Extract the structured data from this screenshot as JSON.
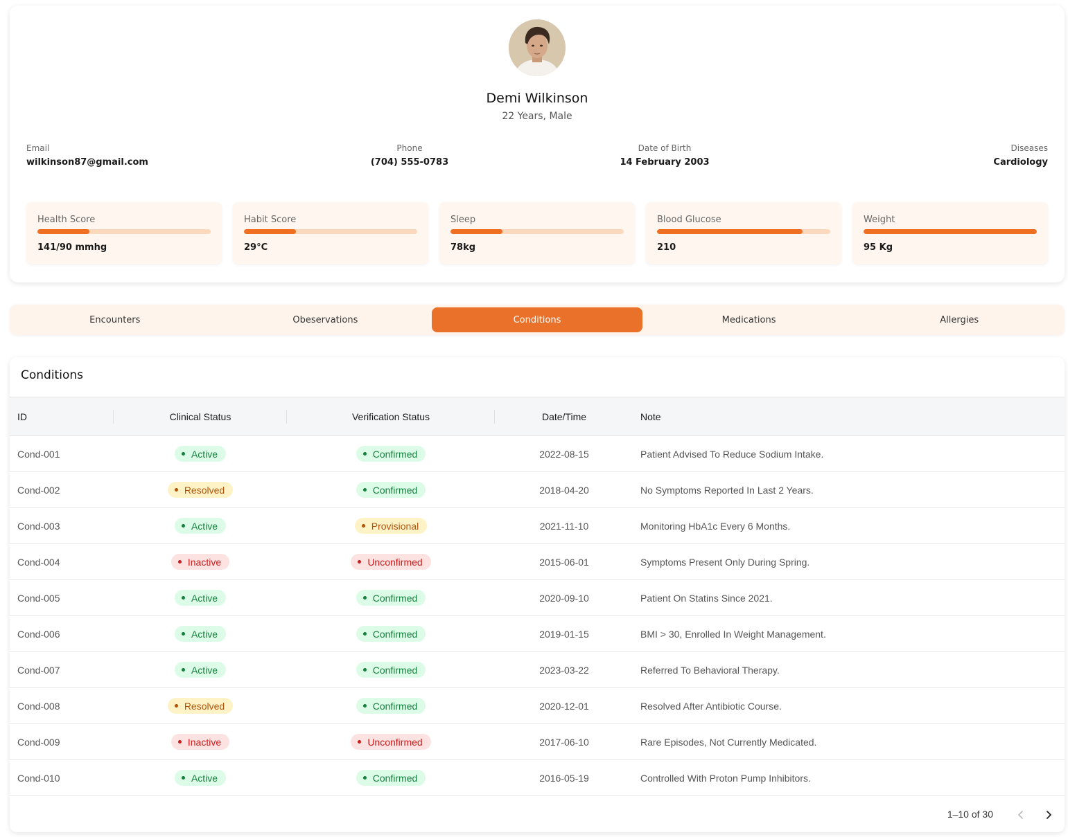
{
  "profile": {
    "name": "Demi Wilkinson",
    "subtitle": "22 Years, Male",
    "fields": {
      "email": {
        "label": "Email",
        "value": "wilkinson87@gmail.com"
      },
      "phone": {
        "label": "Phone",
        "value": "(704) 555-0783"
      },
      "dob": {
        "label": "Date of Birth",
        "value": "14 February 2003"
      },
      "diseases": {
        "label": "Diseases",
        "value": "Cardiology"
      }
    },
    "metrics": [
      {
        "label": "Health Score",
        "value": "141/90 mmhg",
        "progress": 0.3
      },
      {
        "label": "Habit Score",
        "value": "29°C",
        "progress": 0.3
      },
      {
        "label": "Sleep",
        "value": "78kg",
        "progress": 0.3
      },
      {
        "label": "Blood Glucose",
        "value": "210",
        "progress": 0.84
      },
      {
        "label": "Weight",
        "value": "95 Kg",
        "progress": 1.0
      }
    ]
  },
  "tabs": [
    {
      "label": "Encounters",
      "active": false
    },
    {
      "label": "Obeservations",
      "active": false
    },
    {
      "label": "Conditions",
      "active": true
    },
    {
      "label": "Medications",
      "active": false
    },
    {
      "label": "Allergies",
      "active": false
    }
  ],
  "conditions": {
    "title": "Conditions",
    "columns": {
      "id": "ID",
      "clinical": "Clinical Status",
      "verification": "Verification Status",
      "datetime": "Date/Time",
      "note": "Note"
    },
    "rows": [
      {
        "id": "Cond-001",
        "clinical": "Active",
        "clinical_color": "green",
        "verification": "Confirmed",
        "verification_color": "green",
        "date": "2022-08-15",
        "note": "Patient Advised To Reduce Sodium Intake."
      },
      {
        "id": "Cond-002",
        "clinical": "Resolved",
        "clinical_color": "yellow",
        "verification": "Confirmed",
        "verification_color": "green",
        "date": "2018-04-20",
        "note": "No Symptoms Reported In Last 2 Years."
      },
      {
        "id": "Cond-003",
        "clinical": "Active",
        "clinical_color": "green",
        "verification": "Provisional",
        "verification_color": "yellow",
        "date": "2021-11-10",
        "note": "Monitoring HbA1c Every 6 Months."
      },
      {
        "id": "Cond-004",
        "clinical": "Inactive",
        "clinical_color": "red",
        "verification": "Unconfirmed",
        "verification_color": "red",
        "date": "2015-06-01",
        "note": "Symptoms Present Only During Spring."
      },
      {
        "id": "Cond-005",
        "clinical": "Active",
        "clinical_color": "green",
        "verification": "Confirmed",
        "verification_color": "green",
        "date": "2020-09-10",
        "note": "Patient On Statins Since 2021."
      },
      {
        "id": "Cond-006",
        "clinical": "Active",
        "clinical_color": "green",
        "verification": "Confirmed",
        "verification_color": "green",
        "date": "2019-01-15",
        "note": "BMI > 30, Enrolled In Weight Management."
      },
      {
        "id": "Cond-007",
        "clinical": "Active",
        "clinical_color": "green",
        "verification": "Confirmed",
        "verification_color": "green",
        "date": "2023-03-22",
        "note": "Referred To Behavioral Therapy."
      },
      {
        "id": "Cond-008",
        "clinical": "Resolved",
        "clinical_color": "yellow",
        "verification": "Confirmed",
        "verification_color": "green",
        "date": "2020-12-01",
        "note": "Resolved After Antibiotic Course."
      },
      {
        "id": "Cond-009",
        "clinical": "Inactive",
        "clinical_color": "red",
        "verification": "Unconfirmed",
        "verification_color": "red",
        "date": "2017-06-10",
        "note": "Rare Episodes, Not Currently Medicated."
      },
      {
        "id": "Cond-010",
        "clinical": "Active",
        "clinical_color": "green",
        "verification": "Confirmed",
        "verification_color": "green",
        "date": "2016-05-19",
        "note": "Controlled With Proton Pump Inhibitors."
      }
    ],
    "pagination": "1–10 of 30"
  },
  "colors": {
    "accent": "#ea7129",
    "bar_fill": "#ee6f22",
    "bar_track": "#fcd9bc"
  },
  "icons": {
    "prev": "chevron-left-icon",
    "next": "chevron-right-icon"
  }
}
